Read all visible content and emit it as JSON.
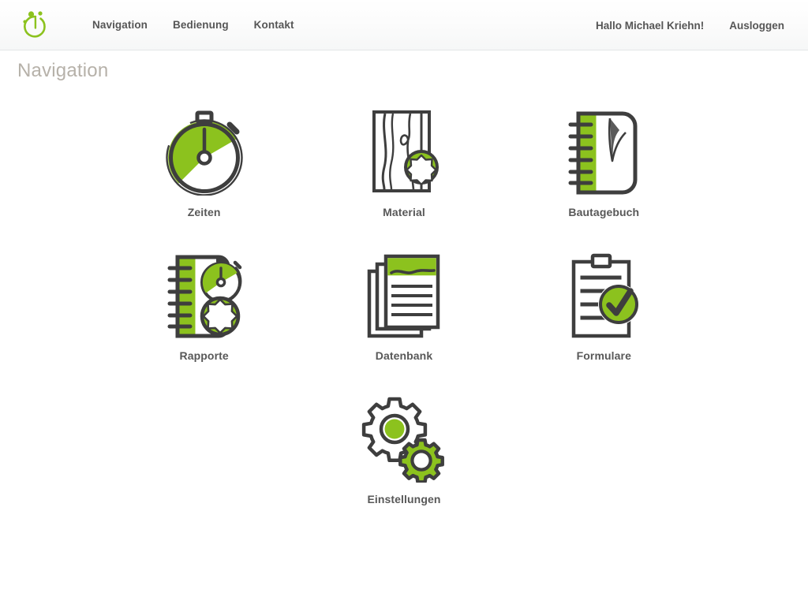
{
  "header": {
    "logo_icon": "stopwatch-logo-icon",
    "nav_items": [
      {
        "label": "Navigation",
        "name": "nav-link-navigation"
      },
      {
        "label": "Bedienung",
        "name": "nav-link-bedienung"
      },
      {
        "label": "Kontakt",
        "name": "nav-link-kontakt"
      }
    ],
    "greeting": "Hallo Michael Kriehn!",
    "logout_label": "Ausloggen"
  },
  "page": {
    "title": "Navigation"
  },
  "tiles": [
    {
      "label": "Zeiten",
      "icon": "stopwatch-icon"
    },
    {
      "label": "Material",
      "icon": "wood-panel-star-badge-icon"
    },
    {
      "label": "Bautagebuch",
      "icon": "spiral-notebook-icon"
    },
    {
      "label": "Rapporte",
      "icon": "notebook-stopwatch-star-icon"
    },
    {
      "label": "Datenbank",
      "icon": "stacked-documents-icon"
    },
    {
      "label": "Formulare",
      "icon": "clipboard-check-icon"
    },
    {
      "label": "Einstellungen",
      "icon": "gears-icon"
    }
  ],
  "colors": {
    "accent_green": "#8cc21e",
    "dark_gray": "#434343",
    "text_gray": "#585858",
    "title_gray": "#b6b1a9",
    "header_border": "#e3e6e7"
  }
}
